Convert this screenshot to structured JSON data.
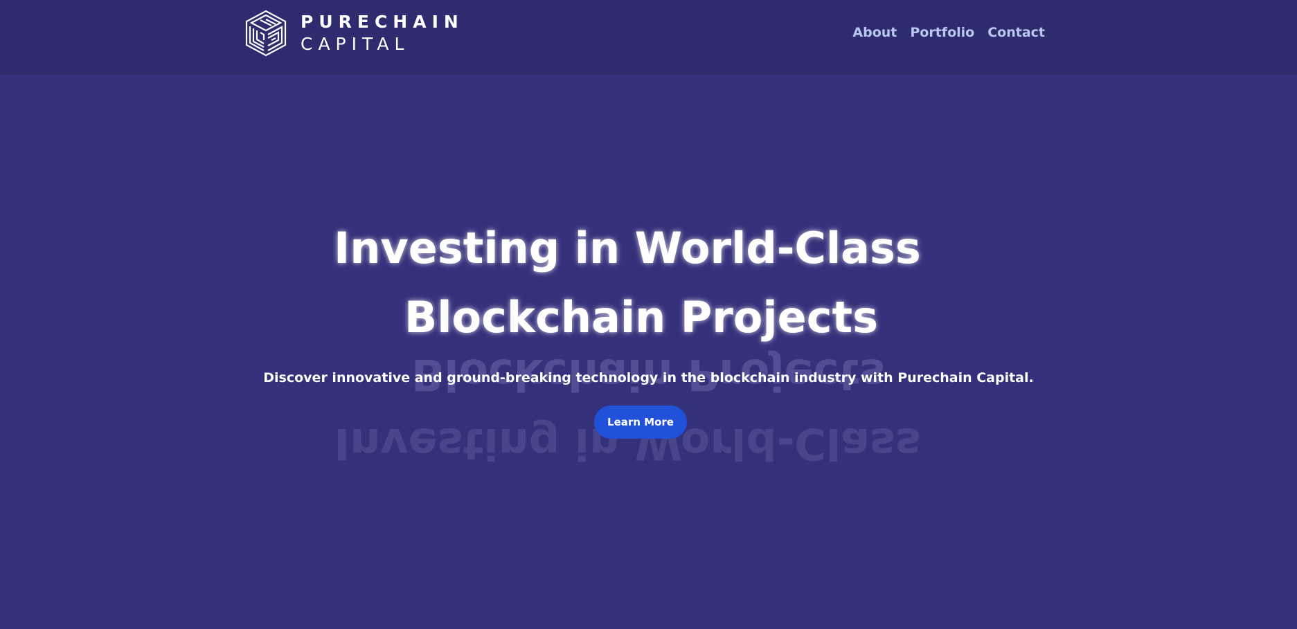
{
  "brand": {
    "line1": "PURECHAIN",
    "line2": "CAPITAL",
    "logo_icon": "cube-maze-icon"
  },
  "nav": {
    "items": [
      {
        "label": "About"
      },
      {
        "label": "Portfolio"
      },
      {
        "label": "Contact"
      }
    ]
  },
  "hero": {
    "title_line1": "Investing in World-Class",
    "title_line2": "Blockchain Projects",
    "subtitle": "Discover innovative and ground-breaking technology in the blockchain industry with Purechain Capital.",
    "cta_label": "Learn More"
  },
  "colors": {
    "header_bg": "#2e2b6f",
    "page_bg": "#34307a",
    "nav_text": "#b9c8f2",
    "cta_bg": "#2151d8"
  }
}
